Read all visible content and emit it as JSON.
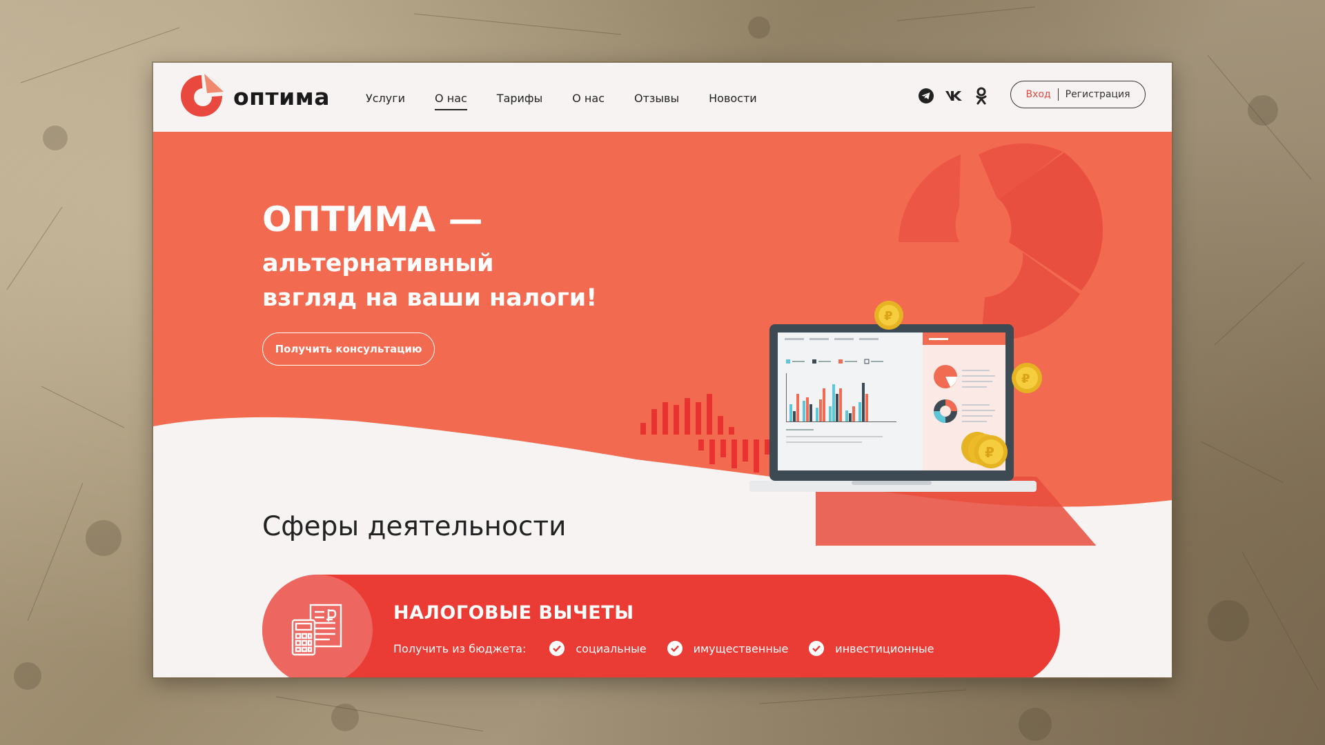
{
  "brand": {
    "name": "оптима",
    "accent": "#e8483d"
  },
  "nav": {
    "items": [
      {
        "label": "Услуги",
        "active": false
      },
      {
        "label": "О нас",
        "active": true
      },
      {
        "label": "Тарифы",
        "active": false
      },
      {
        "label": "О нас",
        "active": false
      },
      {
        "label": "Отзывы",
        "active": false
      },
      {
        "label": "Новости",
        "active": false
      }
    ]
  },
  "social": {
    "icons": [
      "telegram-icon",
      "vk-icon",
      "odnoklassniki-icon"
    ]
  },
  "auth": {
    "login_label": "Вход",
    "register_label": "Регистрация"
  },
  "hero": {
    "title": "ОПТИМА —",
    "subtitle_line1": "альтернативный",
    "subtitle_line2": "взгляд на ваши налоги!",
    "cta_label": "Получить консультацию",
    "bg_color": "#f26b50"
  },
  "section": {
    "title": "Сферы деятельности"
  },
  "card": {
    "title": "НАЛОГОВЫЕ ВЫЧЕТЫ",
    "lead": "Получить из бюджета:",
    "options": [
      "социальные",
      "имущественные",
      "инвестиционные"
    ],
    "bg_color": "#ea3b35"
  }
}
